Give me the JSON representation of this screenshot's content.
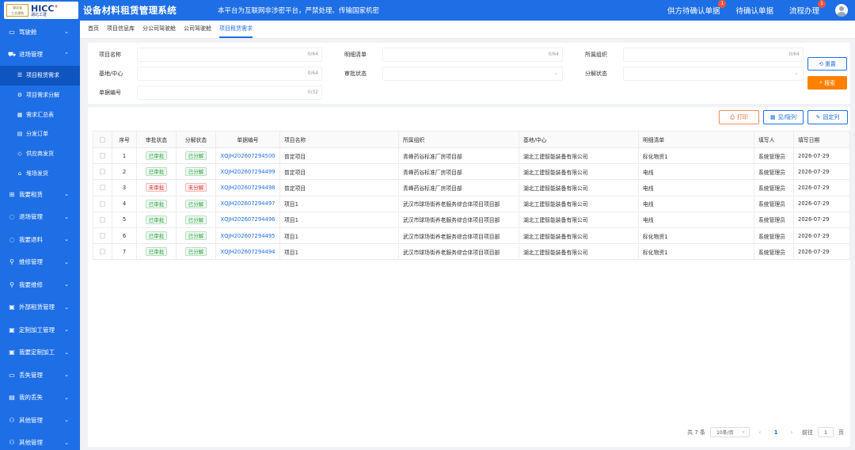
{
  "header": {
    "logo": {
      "seal": "湖北省工业建筑集团 HICC",
      "brand": "HICC",
      "brand_sub": "湖北工建",
      "seal_caption": "中国总承包企业"
    },
    "title": "设备材料租赁管理系统",
    "notice": "本平台为互联网非涉密平台，严禁处理、传输国家机密",
    "items": [
      {
        "label": "供方待确认单据",
        "badge": "1"
      },
      {
        "label": "待确认单据",
        "badge": ""
      },
      {
        "label": "流程办理",
        "badge": "1"
      }
    ]
  },
  "sidebar": {
    "items": [
      {
        "label": "驾驶舱",
        "icon": "monitor-icon",
        "expanded": false
      },
      {
        "label": "进场管理",
        "icon": "truck-icon",
        "expanded": true,
        "children": [
          {
            "label": "项目租赁需求",
            "icon": "list-icon",
            "active": true
          },
          {
            "label": "项目需求分解",
            "icon": "split-icon"
          },
          {
            "label": "需求汇总表",
            "icon": "table-icon"
          },
          {
            "label": "分发订单",
            "icon": "order-icon"
          },
          {
            "label": "供应商发货",
            "icon": "ship-icon"
          },
          {
            "label": "堆场发货",
            "icon": "home-icon"
          }
        ]
      },
      {
        "label": "我要租赁",
        "icon": "cart-icon"
      },
      {
        "label": "退场管理",
        "icon": "exit-icon"
      },
      {
        "label": "我要退料",
        "icon": "return-icon"
      },
      {
        "label": "维修管理",
        "icon": "wrench-icon"
      },
      {
        "label": "我要维修",
        "icon": "user-icon"
      },
      {
        "label": "外部租赁管理",
        "icon": "external-icon"
      },
      {
        "label": "定制加工管理",
        "icon": "tool-icon"
      },
      {
        "label": "我要定制加工",
        "icon": "tool2-icon"
      },
      {
        "label": "丢失管理",
        "icon": "lost-icon"
      },
      {
        "label": "我的丢失",
        "icon": "lost2-icon"
      },
      {
        "label": "其他管理",
        "icon": "group-icon"
      },
      {
        "label": "其他管理",
        "icon": "group-icon"
      }
    ]
  },
  "tabs": [
    {
      "label": "首页",
      "active": false
    },
    {
      "label": "项目信息库",
      "active": false
    },
    {
      "label": "分公司驾驶舱",
      "active": false
    },
    {
      "label": "公司驾驶舱",
      "active": false
    },
    {
      "label": "项目租赁需求",
      "active": true
    }
  ],
  "filters": {
    "project_name": {
      "label": "项目名称",
      "count": "0/64"
    },
    "detail_list": {
      "label": "明细清单",
      "count": "0/64"
    },
    "org": {
      "label": "所属组织",
      "count": "0/64"
    },
    "base": {
      "label": "基地/中心",
      "count": "0/64"
    },
    "approval": {
      "label": "审批状态"
    },
    "split": {
      "label": "分解状态"
    },
    "doc_no": {
      "label": "单据编号",
      "count": "0/32"
    },
    "reset_label": "重置",
    "search_label": "搜索"
  },
  "actions": {
    "print": "打印",
    "show_cols": "显/隐列",
    "fix_cols": "固定列"
  },
  "table": {
    "headers": [
      "序号",
      "审批状态",
      "分解状态",
      "单据编号",
      "项目名称",
      "所属组织",
      "基地/中心",
      "明细清单",
      "填写人",
      "填写日期"
    ],
    "rows": [
      {
        "no": "1",
        "approval": "已审批",
        "approval_ok": true,
        "split": "已分解",
        "split_ok": true,
        "doc": "XQJH202607294500",
        "project": "普定项目",
        "org": "青峰药谷标准厂房项目部",
        "base": "湖北工建智能装备有限公司",
        "detail": "标化物资1",
        "writer": "系统管理员",
        "date": "2026-07-29"
      },
      {
        "no": "2",
        "approval": "已审批",
        "approval_ok": true,
        "split": "已分解",
        "split_ok": true,
        "doc": "XQJH202607294499",
        "project": "普定项目",
        "org": "青峰药谷标准厂房项目部",
        "base": "湖北工建智能装备有限公司",
        "detail": "电线",
        "writer": "系统管理员",
        "date": "2026-07-29"
      },
      {
        "no": "3",
        "approval": "未审批",
        "approval_ok": false,
        "split": "未分解",
        "split_ok": false,
        "doc": "XQJH202607294498",
        "project": "普定项目",
        "org": "青峰药谷标准厂房项目部",
        "base": "湖北工建智能装备有限公司",
        "detail": "电线",
        "writer": "系统管理员",
        "date": "2026-07-29"
      },
      {
        "no": "4",
        "approval": "已审批",
        "approval_ok": true,
        "split": "已分解",
        "split_ok": true,
        "doc": "XQJH202607294497",
        "project": "项目1",
        "org": "武汉市球场街养老服务综合体项目项目部",
        "base": "湖北工建智能装备有限公司",
        "detail": "电线",
        "writer": "系统管理员",
        "date": "2026-07-29"
      },
      {
        "no": "5",
        "approval": "已审批",
        "approval_ok": true,
        "split": "已分解",
        "split_ok": true,
        "doc": "XQJH202607294496",
        "project": "项目1",
        "org": "武汉市球场街养老服务综合体项目项目部",
        "base": "湖北工建智能装备有限公司",
        "detail": "电线",
        "writer": "系统管理员",
        "date": "2026-07-29"
      },
      {
        "no": "6",
        "approval": "已审批",
        "approval_ok": true,
        "split": "已分解",
        "split_ok": true,
        "doc": "XQJH202607294495",
        "project": "项目1",
        "org": "武汉市球场街养老服务综合体项目项目部",
        "base": "湖北工建智能装备有限公司",
        "detail": "标化物资1",
        "writer": "系统管理员",
        "date": "2026-07-29"
      },
      {
        "no": "7",
        "approval": "已审批",
        "approval_ok": true,
        "split": "已分解",
        "split_ok": true,
        "doc": "XQJH202607294494",
        "project": "项目1",
        "org": "武汉市球场街养老服务综合体项目项目部",
        "base": "湖北工建智能装备有限公司",
        "detail": "标化物资1",
        "writer": "系统管理员",
        "date": "2026-07-29"
      }
    ]
  },
  "pagination": {
    "total": "共 7 条",
    "page_size": "10条/页",
    "current": "1",
    "goto_label": "前往",
    "goto_value": "1",
    "page_suffix": "页"
  }
}
